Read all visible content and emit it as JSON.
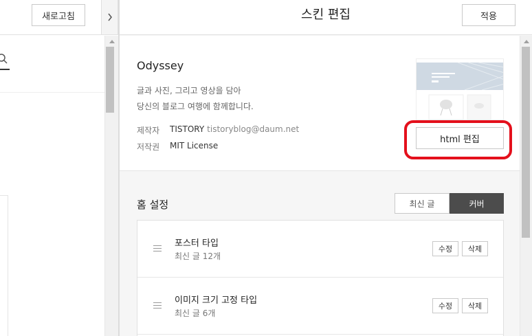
{
  "left_panel": {
    "refresh_label": "새로고침",
    "toggle_icon": "chevron-right-icon",
    "search_icon": "search-icon"
  },
  "header": {
    "title": "스킨 편집",
    "apply_label": "적용"
  },
  "skin": {
    "name": "Odyssey",
    "description_line1": "글과 사진, 그리고 영상을 담아",
    "description_line2": "당신의 블로그 여행에 함께합니다.",
    "author_label": "제작자",
    "author_name": "TISTORY",
    "author_email": "tistoryblog@daum.net",
    "license_label": "저작권",
    "license_value": "MIT License",
    "html_edit_label": "html 편집",
    "highlight_color": "#e4101c"
  },
  "home_settings": {
    "title": "홈 설정",
    "tabs": [
      {
        "label": "최신 글",
        "active": false
      },
      {
        "label": "커버",
        "active": true
      }
    ],
    "items": [
      {
        "title": "포스터 타입",
        "subtitle": "최신 글 12개",
        "edit_label": "수정",
        "delete_label": "삭제"
      },
      {
        "title": "이미지 크기 고정 타입",
        "subtitle": "최신 글 6개",
        "edit_label": "수정",
        "delete_label": "삭제"
      }
    ]
  },
  "colors": {
    "active_tab_bg": "#4c4c4c",
    "pane_bg": "#f6f6f6"
  }
}
